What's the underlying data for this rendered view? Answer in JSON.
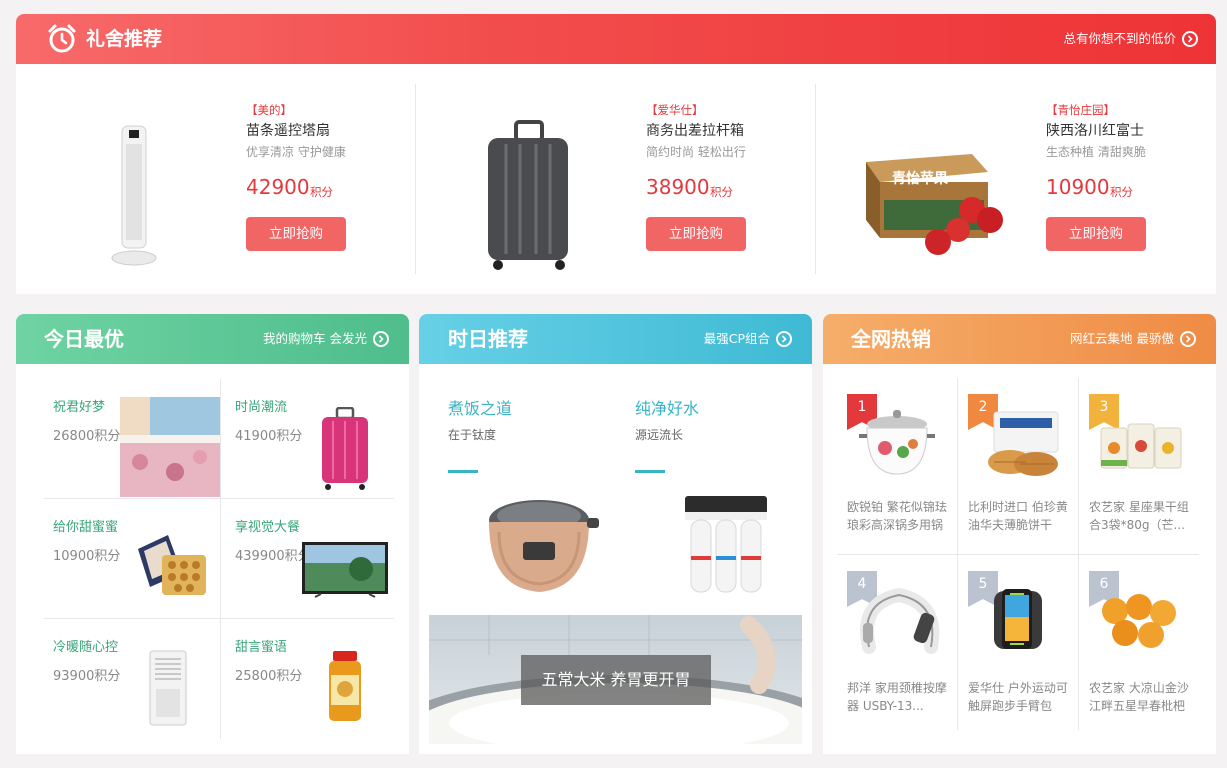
{
  "gift": {
    "title": "礼舍推荐",
    "more": "总有你想不到的低价",
    "items": [
      {
        "brand": "【美的】",
        "name": "苗条遥控塔扇",
        "desc": "优享清凉 守护健康",
        "price": "42900",
        "unit": "积分",
        "button": "立即抢购",
        "image": "tower-fan"
      },
      {
        "brand": "【爱华仕】",
        "name": "商务出差拉杆箱",
        "desc": "简约时尚 轻松出行",
        "price": "38900",
        "unit": "积分",
        "button": "立即抢购",
        "image": "suitcase"
      },
      {
        "brand": "【青怡庄园】",
        "name": "陕西洛川红富士",
        "desc": "生态种植 清甜爽脆",
        "price": "10900",
        "unit": "积分",
        "button": "立即抢购",
        "image": "apple-box",
        "box_text": "青怡苹果"
      }
    ]
  },
  "today": {
    "title": "今日最优",
    "more": "我的购物车 会发光",
    "items": [
      {
        "title": "祝君好梦",
        "price": "26800积分",
        "image": "bedding"
      },
      {
        "title": "时尚潮流",
        "price": "41900积分",
        "image": "pink-suitcase"
      },
      {
        "title": "给你甜蜜蜜",
        "price": "10900积分",
        "image": "cookie-box"
      },
      {
        "title": "享视觉大餐",
        "price": "439900积分",
        "image": "tv"
      },
      {
        "title": "冷暖随心控",
        "price": "93900积分",
        "image": "air-cooler"
      },
      {
        "title": "甜言蜜语",
        "price": "25800积分",
        "image": "honey-jar"
      }
    ]
  },
  "daily": {
    "title": "时日推荐",
    "more": "最强CP组合",
    "items": [
      {
        "title": "煮饭之道",
        "desc": "在于钛度",
        "image": "rice-cooker"
      },
      {
        "title": "纯净好水",
        "desc": "源远流长",
        "image": "water-purifier"
      }
    ],
    "banner": {
      "text": "五常大米 养胃更开胃",
      "image": "rice-bowl"
    }
  },
  "hot": {
    "title": "全网热销",
    "more": "网红云集地 最骄傲",
    "items": [
      {
        "rank": "1",
        "desc": "欧锐铂 繁花似锦珐琅彩高深锅多用锅",
        "rank_color": "#e4393c",
        "image": "enamel-pot"
      },
      {
        "rank": "2",
        "desc": "比利时进口 伯珍黄油华夫薄脆饼干",
        "rank_color": "#f08840",
        "image": "waffle-cookies"
      },
      {
        "rank": "3",
        "desc": "农艺家 星座果干组合3袋*80g（芒...",
        "rank_color": "#f2b33d",
        "image": "dried-fruit"
      },
      {
        "rank": "4",
        "desc": "邦洋 家用颈椎按摩器 USBY-13...",
        "rank_color": "#bcc3d0",
        "image": "neck-massager"
      },
      {
        "rank": "5",
        "desc": "爱华仕 户外运动可触屏跑步手臂包",
        "rank_color": "#bcc3d0",
        "image": "arm-bag"
      },
      {
        "rank": "6",
        "desc": "农艺家 大凉山金沙江畔五星早春枇杷",
        "rank_color": "#bcc3d0",
        "image": "loquat"
      }
    ]
  },
  "colors": {
    "red": "#e4393c",
    "green": "#4fbd8c",
    "cyan": "#45c2da",
    "orange": "#f0964c"
  }
}
